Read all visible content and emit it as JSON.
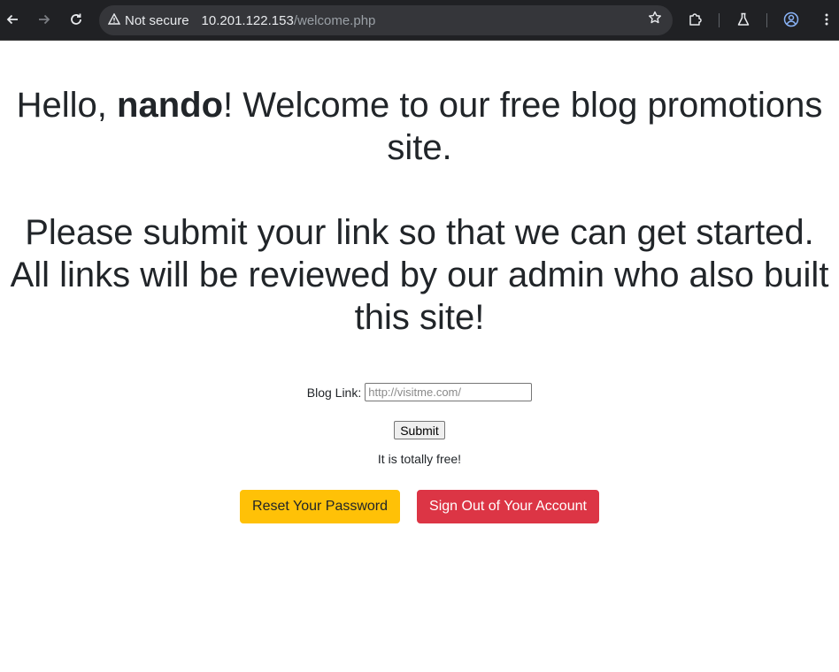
{
  "browser": {
    "security_label": "Not secure",
    "url_host": "10.201.122.153",
    "url_path": "/welcome.php",
    "icons": [
      "back-icon",
      "forward-icon",
      "reload-icon",
      "warning-icon",
      "star-icon",
      "extensions-icon",
      "labs-icon",
      "profile-icon"
    ]
  },
  "page": {
    "greeting_prefix": "Hello, ",
    "username": "nando",
    "greeting_suffix": "! Welcome to our free blog promotions site.",
    "instructions": "Please submit your link so that we can get started. All links will be reviewed by our admin who also built this site!",
    "form": {
      "label": "Blog Link:",
      "input_value": "",
      "input_placeholder": "http://visitme.com/",
      "submit_label": "Submit"
    },
    "free_note": "It is totally free!",
    "buttons": {
      "reset_password": "Reset Your Password",
      "sign_out": "Sign Out of Your Account"
    }
  },
  "colors": {
    "warning": "#ffc107",
    "danger": "#dc3545",
    "chrome_bg": "#202124",
    "text": "#212529"
  }
}
